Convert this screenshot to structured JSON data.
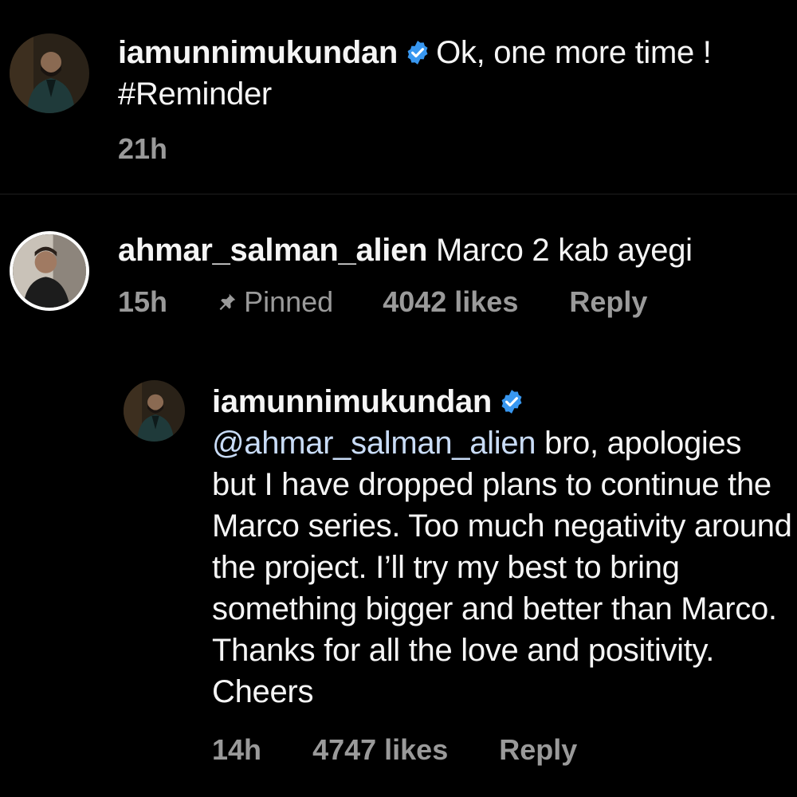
{
  "comments": [
    {
      "username": "iamunnimukundan",
      "verified": true,
      "text": "Ok, one more time ! #Reminder",
      "time": "21h"
    },
    {
      "username": "ahmar_salman_alien",
      "verified": false,
      "text": "Marco 2 kab ayegi",
      "time": "15h",
      "pinned_label": "Pinned",
      "likes": "4042 likes",
      "reply_label": "Reply",
      "replies": [
        {
          "username": "iamunnimukundan",
          "verified": true,
          "mention": "@ahmar_salman_alien",
          "text": "bro, apologies but I have dropped plans to continue the Marco series. Too much negativity around the project. I’ll try my best to bring something bigger and better than Marco. Thanks for all the love and positivity. Cheers",
          "time": "14h",
          "likes": "4747 likes",
          "reply_label": "Reply"
        }
      ]
    }
  ],
  "icons": {
    "verified": "verified-badge-icon",
    "pin": "pin-icon"
  },
  "colors": {
    "background": "#000000",
    "text": "#f5f5f5",
    "meta": "#9a9a9a",
    "verified": "#3897f0",
    "mention": "#c9dcf7"
  }
}
